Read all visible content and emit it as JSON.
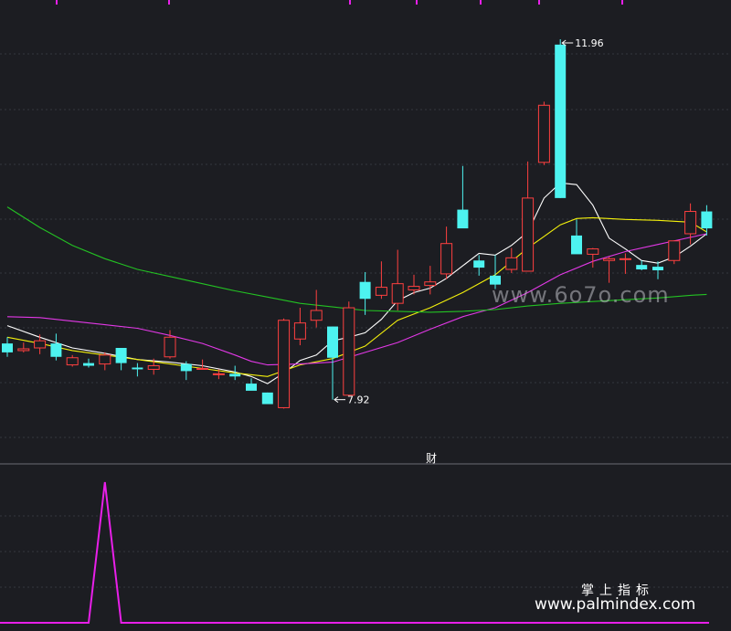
{
  "watermarks": {
    "center": "www.6o7o.com",
    "brand_cn": "掌上指标",
    "brand_url": "www.palmindex.com"
  },
  "colors": {
    "background": "#1c1d22",
    "grid": "#34363d",
    "up": "#ff4040",
    "down": "#4df3f0",
    "ma_white": "#ffffff",
    "ma_yellow": "#f4f10c",
    "ma_magenta": "#e238e6",
    "ma_green": "#23c223",
    "indicator": "#e81fe9",
    "label": "#ffffff",
    "top_tick": "#e81fe9"
  },
  "chart_data": [
    {
      "type": "candlestick",
      "title": "",
      "marker_text": "财",
      "ylim": [
        7.2,
        12.4
      ],
      "annotations": [
        {
          "text": "11.96",
          "x": 34,
          "y": 11.96,
          "kind": "high"
        },
        {
          "text": "7.92",
          "x": 20,
          "y": 7.92,
          "kind": "low"
        }
      ],
      "candles": [
        {
          "x": 0,
          "o": 8.55,
          "h": 8.62,
          "l": 8.4,
          "c": 8.45
        },
        {
          "x": 1,
          "o": 8.47,
          "h": 8.56,
          "l": 8.45,
          "c": 8.49
        },
        {
          "x": 2,
          "o": 8.5,
          "h": 8.65,
          "l": 8.43,
          "c": 8.58
        },
        {
          "x": 3,
          "o": 8.55,
          "h": 8.66,
          "l": 8.36,
          "c": 8.4
        },
        {
          "x": 4,
          "o": 8.31,
          "h": 8.42,
          "l": 8.29,
          "c": 8.39
        },
        {
          "x": 5,
          "o": 8.33,
          "h": 8.38,
          "l": 8.28,
          "c": 8.3
        },
        {
          "x": 6,
          "o": 8.32,
          "h": 8.45,
          "l": 8.25,
          "c": 8.42
        },
        {
          "x": 7,
          "o": 8.5,
          "h": 8.5,
          "l": 8.25,
          "c": 8.33
        },
        {
          "x": 8,
          "o": 8.28,
          "h": 8.33,
          "l": 8.18,
          "c": 8.26
        },
        {
          "x": 9,
          "o": 8.26,
          "h": 8.38,
          "l": 8.2,
          "c": 8.3
        },
        {
          "x": 10,
          "o": 8.4,
          "h": 8.7,
          "l": 8.38,
          "c": 8.62
        },
        {
          "x": 11,
          "o": 8.32,
          "h": 8.35,
          "l": 8.14,
          "c": 8.24
        },
        {
          "x": 12,
          "o": 8.26,
          "h": 8.37,
          "l": 8.26,
          "c": 8.27
        },
        {
          "x": 13,
          "o": 8.2,
          "h": 8.26,
          "l": 8.15,
          "c": 8.21
        },
        {
          "x": 14,
          "o": 8.21,
          "h": 8.3,
          "l": 8.14,
          "c": 8.18
        },
        {
          "x": 15,
          "o": 8.1,
          "h": 8.16,
          "l": 8.03,
          "c": 8.02
        },
        {
          "x": 16,
          "o": 8.0,
          "h": 8.0,
          "l": 7.98,
          "c": 7.87
        },
        {
          "x": 17,
          "o": 7.83,
          "h": 8.83,
          "l": 7.82,
          "c": 8.81
        },
        {
          "x": 18,
          "o": 8.6,
          "h": 8.95,
          "l": 8.53,
          "c": 8.78
        },
        {
          "x": 19,
          "o": 8.81,
          "h": 9.15,
          "l": 8.73,
          "c": 8.92
        },
        {
          "x": 20,
          "o": 8.74,
          "h": 8.74,
          "l": 7.92,
          "c": 8.39
        },
        {
          "x": 21,
          "o": 7.97,
          "h": 9.02,
          "l": 7.96,
          "c": 8.95
        },
        {
          "x": 22,
          "o": 9.24,
          "h": 9.35,
          "l": 8.87,
          "c": 9.05
        },
        {
          "x": 23,
          "o": 9.09,
          "h": 9.47,
          "l": 9.05,
          "c": 9.18
        },
        {
          "x": 24,
          "o": 9.0,
          "h": 9.6,
          "l": 8.92,
          "c": 9.22
        },
        {
          "x": 25,
          "o": 9.15,
          "h": 9.32,
          "l": 9.1,
          "c": 9.19
        },
        {
          "x": 26,
          "o": 9.2,
          "h": 9.42,
          "l": 9.1,
          "c": 9.24
        },
        {
          "x": 27,
          "o": 9.33,
          "h": 9.86,
          "l": 9.27,
          "c": 9.67
        },
        {
          "x": 28,
          "o": 10.05,
          "h": 10.54,
          "l": 9.85,
          "c": 9.84
        },
        {
          "x": 29,
          "o": 9.48,
          "h": 9.54,
          "l": 9.31,
          "c": 9.4
        },
        {
          "x": 30,
          "o": 9.31,
          "h": 9.54,
          "l": 9.16,
          "c": 9.21
        },
        {
          "x": 31,
          "o": 9.38,
          "h": 9.62,
          "l": 9.34,
          "c": 9.51
        },
        {
          "x": 32,
          "o": 9.36,
          "h": 10.59,
          "l": 9.36,
          "c": 10.18
        },
        {
          "x": 33,
          "o": 10.58,
          "h": 11.26,
          "l": 10.55,
          "c": 11.22
        },
        {
          "x": 34,
          "o": 11.9,
          "h": 11.96,
          "l": 10.18,
          "c": 10.18
        },
        {
          "x": 35,
          "o": 9.76,
          "h": 9.94,
          "l": 9.56,
          "c": 9.55
        },
        {
          "x": 36,
          "o": 9.55,
          "h": 9.62,
          "l": 9.4,
          "c": 9.61
        },
        {
          "x": 37,
          "o": 9.48,
          "h": 9.52,
          "l": 9.23,
          "c": 9.5
        },
        {
          "x": 38,
          "o": 9.49,
          "h": 9.56,
          "l": 9.33,
          "c": 9.5
        },
        {
          "x": 39,
          "o": 9.43,
          "h": 9.48,
          "l": 9.37,
          "c": 9.38
        },
        {
          "x": 40,
          "o": 9.41,
          "h": 9.47,
          "l": 9.27,
          "c": 9.37
        },
        {
          "x": 41,
          "o": 9.48,
          "h": 9.63,
          "l": 9.44,
          "c": 9.7
        },
        {
          "x": 42,
          "o": 9.78,
          "h": 10.12,
          "l": 9.66,
          "c": 10.03
        },
        {
          "x": 43,
          "o": 10.03,
          "h": 10.1,
          "l": 9.76,
          "c": 9.84
        }
      ],
      "series": [
        {
          "color": "#ffffff",
          "x": [
            0,
            2,
            4,
            6,
            8,
            10,
            12,
            14,
            15,
            16,
            17,
            18,
            19,
            20,
            21,
            22,
            23,
            24,
            25,
            26,
            27,
            28,
            29,
            30,
            31,
            32,
            33,
            34,
            35,
            36,
            37,
            38,
            39,
            40,
            41,
            42,
            43
          ],
          "y": [
            8.75,
            8.62,
            8.5,
            8.44,
            8.37,
            8.34,
            8.3,
            8.23,
            8.18,
            8.1,
            8.22,
            8.36,
            8.42,
            8.58,
            8.62,
            8.67,
            8.82,
            9.03,
            9.12,
            9.17,
            9.28,
            9.42,
            9.56,
            9.54,
            9.65,
            9.8,
            10.18,
            10.35,
            10.33,
            10.1,
            9.73,
            9.61,
            9.48,
            9.45,
            9.52,
            9.64,
            9.78
          ]
        },
        {
          "color": "#f4f10c",
          "x": [
            0,
            2,
            4,
            6,
            8,
            10,
            12,
            14,
            16,
            18,
            20,
            22,
            24,
            26,
            28,
            30,
            32,
            33,
            34,
            35,
            36,
            38,
            40,
            42,
            43
          ],
          "y": [
            8.62,
            8.55,
            8.47,
            8.42,
            8.37,
            8.32,
            8.27,
            8.22,
            8.18,
            8.31,
            8.38,
            8.52,
            8.81,
            8.95,
            9.12,
            9.32,
            9.62,
            9.75,
            9.88,
            9.95,
            9.96,
            9.94,
            9.93,
            9.91,
            9.8
          ]
        },
        {
          "color": "#e238e6",
          "x": [
            0,
            2,
            4,
            6,
            8,
            10,
            12,
            14,
            15,
            16,
            18,
            20,
            22,
            24,
            26,
            28,
            30,
            32,
            34,
            36,
            38,
            40,
            42,
            43
          ],
          "y": [
            8.85,
            8.84,
            8.8,
            8.76,
            8.72,
            8.64,
            8.55,
            8.42,
            8.35,
            8.31,
            8.32,
            8.34,
            8.45,
            8.56,
            8.71,
            8.85,
            8.95,
            9.12,
            9.32,
            9.47,
            9.58,
            9.66,
            9.74,
            9.78
          ]
        },
        {
          "color": "#23c223",
          "x": [
            0,
            2,
            4,
            6,
            8,
            10,
            12,
            14,
            16,
            18,
            20,
            22,
            24,
            26,
            28,
            30,
            32,
            34,
            36,
            38,
            40,
            42,
            43
          ],
          "y": [
            10.08,
            9.85,
            9.65,
            9.5,
            9.38,
            9.3,
            9.22,
            9.14,
            9.07,
            9.0,
            8.96,
            8.92,
            8.91,
            8.9,
            8.91,
            8.93,
            8.97,
            9.0,
            9.02,
            9.04,
            9.06,
            9.09,
            9.1
          ]
        }
      ]
    },
    {
      "type": "line",
      "title": "",
      "ylim": [
        0,
        1
      ],
      "series": [
        {
          "color": "#e81fe9",
          "x": [
            0,
            5,
            6,
            7,
            43
          ],
          "y": [
            0,
            0,
            1,
            0,
            0
          ]
        }
      ]
    }
  ]
}
